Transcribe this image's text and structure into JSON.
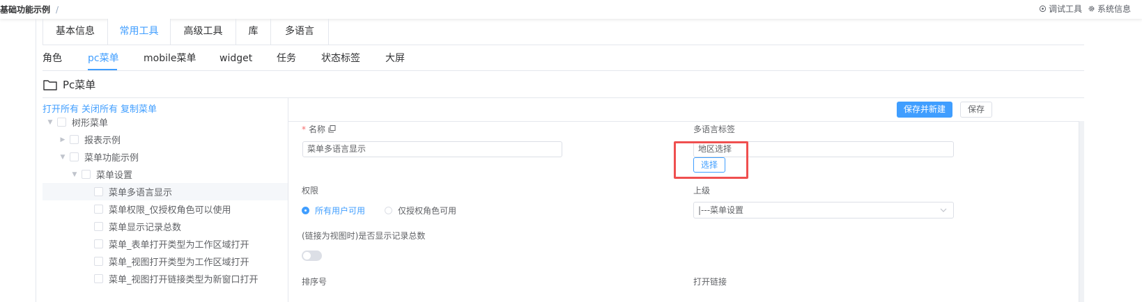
{
  "topbar": {
    "breadcrumb": "基础功能示例",
    "breadcrumb_sep": "/",
    "debug_tools": "调试工具",
    "system_info": "系统信息"
  },
  "tabs_main": [
    {
      "label": "基本信息",
      "active": false
    },
    {
      "label": "常用工具",
      "active": true
    },
    {
      "label": "高级工具",
      "active": false
    },
    {
      "label": "库",
      "active": false
    },
    {
      "label": "多语言",
      "active": false
    }
  ],
  "tabs_sub": [
    {
      "label": "角色",
      "active": false
    },
    {
      "label": "pc菜单",
      "active": true
    },
    {
      "label": "mobile菜单",
      "active": false
    },
    {
      "label": "widget",
      "active": false
    },
    {
      "label": "任务",
      "active": false
    },
    {
      "label": "状态标签",
      "active": false
    },
    {
      "label": "大屏",
      "active": false
    }
  ],
  "section_title": "Pc菜单",
  "tree": {
    "links": [
      "打开所有",
      "关闭所有",
      "复制菜单"
    ],
    "nodes": [
      {
        "label": "树形菜单",
        "expanded": true
      },
      {
        "label": "报表示例",
        "expanded": false
      },
      {
        "label": "菜单功能示例",
        "expanded": true
      },
      {
        "label": "菜单设置",
        "expanded": true
      },
      {
        "label": "菜单多语言显示",
        "selected": true
      },
      {
        "label": "菜单权限_仅授权角色可以使用"
      },
      {
        "label": "菜单显示记录总数"
      },
      {
        "label": "菜单_表单打开类型为工作区域打开"
      },
      {
        "label": "菜单_视图打开类型为工作区域打开"
      },
      {
        "label": "菜单_视图打开链接类型为新窗口打开"
      }
    ]
  },
  "form": {
    "save_new_label": "保存并新建",
    "save_label": "保存",
    "name_label": "名称",
    "name_required": "*",
    "name_value": "菜单多语言显示",
    "i18n_label": "多语言标签",
    "i18n_value": "地区选择",
    "choose_label": "选择",
    "permission_label": "权限",
    "permission_all": "所有用户可用",
    "permission_auth": "仅授权角色可用",
    "permission_selected": "所有用户可用",
    "parent_label": "上级",
    "parent_value": "|---菜单设置",
    "show_count_label": "(链接为视图时)是否显示记录总数",
    "show_count_on": false,
    "sort_label": "排序号",
    "open_link_label": "打开链接"
  },
  "colors": {
    "accent": "#409eff",
    "highlight_box": "#ef4f4f"
  }
}
